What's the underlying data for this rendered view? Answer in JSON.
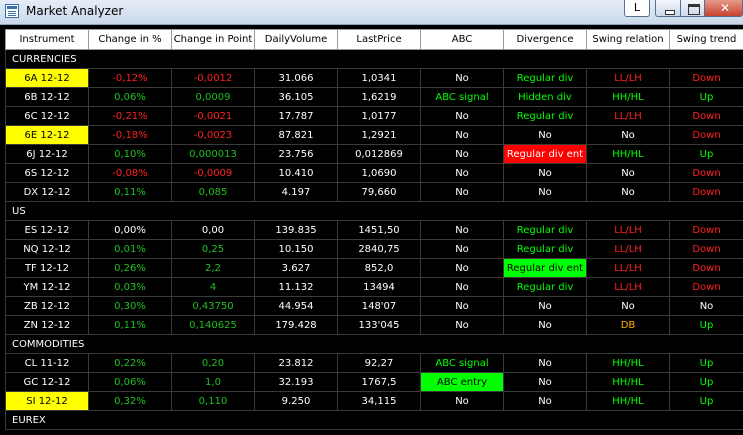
{
  "window": {
    "title": "Market Analyzer",
    "l_button": "L"
  },
  "columns": [
    "Instrument",
    "Change in %",
    "Change in Point",
    "DailyVolume",
    "LastPrice",
    "ABC",
    "Divergence",
    "Swing relation",
    "Swing trend"
  ],
  "colors": {
    "up": "#20c020",
    "down": "#ff2020",
    "highlight": "#ffff00",
    "signal_bg": "#00ff00",
    "alert_bg": "#ff0000",
    "double_bottom": "#ffb000"
  },
  "sections": [
    {
      "name": "CURRENCIES",
      "rows": [
        {
          "instrument": "6A 12-12",
          "highlight": true,
          "change_pct": "-0,12%",
          "change_pt": "-0,0012",
          "volume": "31.066",
          "last": "1,0341",
          "abc": "No",
          "divergence": "Regular div",
          "swing_rel": "LL/LH",
          "trend": "Down"
        },
        {
          "instrument": "6B 12-12",
          "highlight": false,
          "change_pct": "0,06%",
          "change_pt": "0,0009",
          "volume": "36.105",
          "last": "1,6219",
          "abc": "ABC signal",
          "divergence": "Hidden div",
          "swing_rel": "HH/HL",
          "trend": "Up"
        },
        {
          "instrument": "6C 12-12",
          "highlight": false,
          "change_pct": "-0,21%",
          "change_pt": "-0,0021",
          "volume": "17.787",
          "last": "1,0177",
          "abc": "No",
          "divergence": "Regular div",
          "swing_rel": "LL/LH",
          "trend": "Down"
        },
        {
          "instrument": "6E 12-12",
          "highlight": true,
          "change_pct": "-0,18%",
          "change_pt": "-0,0023",
          "volume": "87.821",
          "last": "1,2921",
          "abc": "No",
          "divergence": "No",
          "swing_rel": "No",
          "trend": "Down"
        },
        {
          "instrument": "6J 12-12",
          "highlight": false,
          "change_pct": "0,10%",
          "change_pt": "0,000013",
          "volume": "23.756",
          "last": "0,012869",
          "abc": "No",
          "divergence": "Regular div ent",
          "swing_rel": "HH/HL",
          "trend": "Up"
        },
        {
          "instrument": "6S 12-12",
          "highlight": false,
          "change_pct": "-0,08%",
          "change_pt": "-0,0009",
          "volume": "10.410",
          "last": "1,0690",
          "abc": "No",
          "divergence": "No",
          "swing_rel": "No",
          "trend": "Down"
        },
        {
          "instrument": "DX 12-12",
          "highlight": false,
          "change_pct": "0,11%",
          "change_pt": "0,085",
          "volume": "4.197",
          "last": "79,660",
          "abc": "No",
          "divergence": "No",
          "swing_rel": "No",
          "trend": "Down"
        }
      ]
    },
    {
      "name": "US",
      "rows": [
        {
          "instrument": "ES 12-12",
          "highlight": false,
          "change_pct": "0,00%",
          "change_pt": "0,00",
          "volume": "139.835",
          "last": "1451,50",
          "abc": "No",
          "divergence": "Regular div",
          "swing_rel": "LL/LH",
          "trend": "Down"
        },
        {
          "instrument": "NQ 12-12",
          "highlight": false,
          "change_pct": "0,01%",
          "change_pt": "0,25",
          "volume": "10.150",
          "last": "2840,75",
          "abc": "No",
          "divergence": "Regular div",
          "swing_rel": "LL/LH",
          "trend": "Down"
        },
        {
          "instrument": "TF 12-12",
          "highlight": false,
          "change_pct": "0,26%",
          "change_pt": "2,2",
          "volume": "3.627",
          "last": "852,0",
          "abc": "No",
          "divergence": "Regular div ent",
          "swing_rel": "LL/LH",
          "trend": "Down"
        },
        {
          "instrument": "YM 12-12",
          "highlight": false,
          "change_pct": "0,03%",
          "change_pt": "4",
          "volume": "11.132",
          "last": "13494",
          "abc": "No",
          "divergence": "Regular div",
          "swing_rel": "LL/LH",
          "trend": "Down"
        },
        {
          "instrument": "ZB 12-12",
          "highlight": false,
          "change_pct": "0,30%",
          "change_pt": "0,43750",
          "volume": "44.954",
          "last": "148'07",
          "abc": "No",
          "divergence": "No",
          "swing_rel": "No",
          "trend": "No"
        },
        {
          "instrument": "ZN 12-12",
          "highlight": false,
          "change_pct": "0,11%",
          "change_pt": "0,140625",
          "volume": "179.428",
          "last": "133'045",
          "abc": "No",
          "divergence": "No",
          "swing_rel": "DB",
          "trend": "Up"
        }
      ]
    },
    {
      "name": "COMMODITIES",
      "rows": [
        {
          "instrument": "CL 11-12",
          "highlight": false,
          "change_pct": "0,22%",
          "change_pt": "0,20",
          "volume": "23.812",
          "last": "92,27",
          "abc": "ABC signal",
          "divergence": "No",
          "swing_rel": "HH/HL",
          "trend": "Up"
        },
        {
          "instrument": "GC 12-12",
          "highlight": false,
          "change_pct": "0,06%",
          "change_pt": "1,0",
          "volume": "32.193",
          "last": "1767,5",
          "abc": "ABC entry",
          "divergence": "No",
          "swing_rel": "HH/HL",
          "trend": "Up"
        },
        {
          "instrument": "SI 12-12",
          "highlight": true,
          "change_pct": "0,32%",
          "change_pt": "0,110",
          "volume": "9.250",
          "last": "34,115",
          "abc": "No",
          "divergence": "No",
          "swing_rel": "HH/HL",
          "trend": "Up"
        }
      ]
    },
    {
      "name": "EUREX",
      "rows": []
    }
  ]
}
